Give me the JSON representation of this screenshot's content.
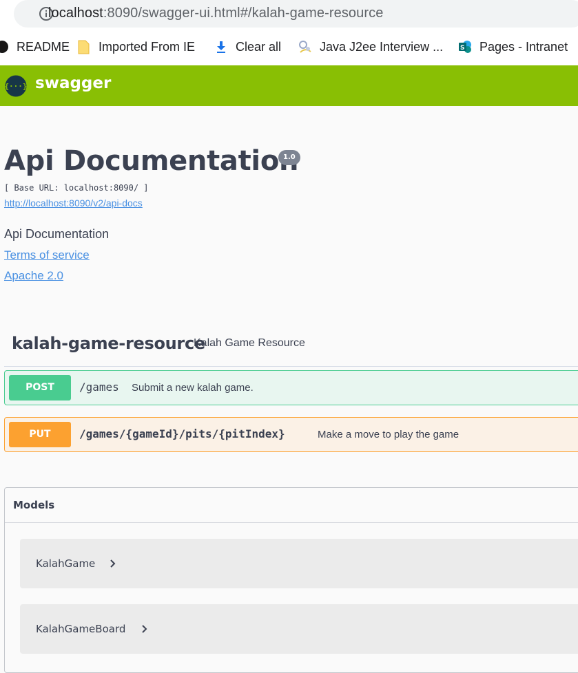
{
  "browser": {
    "url_host": "localhost",
    "url_rest": ":8090/swagger-ui.html#/kalah-game-resource",
    "bookmarks": [
      {
        "label": "README",
        "icon": "github-icon"
      },
      {
        "label": "Imported From IE",
        "icon": "folder-icon"
      },
      {
        "label": "Clear all",
        "icon": "download-icon"
      },
      {
        "label": "Java J2ee Interview ...",
        "icon": "page-icon"
      },
      {
        "label": "Pages - Intranet",
        "icon": "sharepoint-icon"
      }
    ]
  },
  "topbar": {
    "logo_text": "swagger",
    "logo_glyph": "{···}"
  },
  "info": {
    "title": "Api Documentation",
    "version": "1.0",
    "base_url": "[ Base URL: localhost:8090/ ]",
    "spec_url": "http://localhost:8090/v2/api-docs",
    "description": "Api Documentation",
    "terms": "Terms of service",
    "license": "Apache 2.0"
  },
  "tag": {
    "name": "kalah-game-resource",
    "description": "Kalah Game Resource",
    "operations": [
      {
        "method": "POST",
        "path": "/games",
        "summary": "Submit a new kalah game.",
        "color": "#49cc90"
      },
      {
        "method": "PUT",
        "path": "/games/{gameId}/pits/{pitIndex}",
        "summary": "Make a move to play the game",
        "color": "#fca130"
      }
    ]
  },
  "models": {
    "title": "Models",
    "items": [
      "KalahGame",
      "KalahGameBoard"
    ]
  },
  "colors": {
    "brand": "#89bf04",
    "link": "#4990e2",
    "text": "#3b4151"
  }
}
